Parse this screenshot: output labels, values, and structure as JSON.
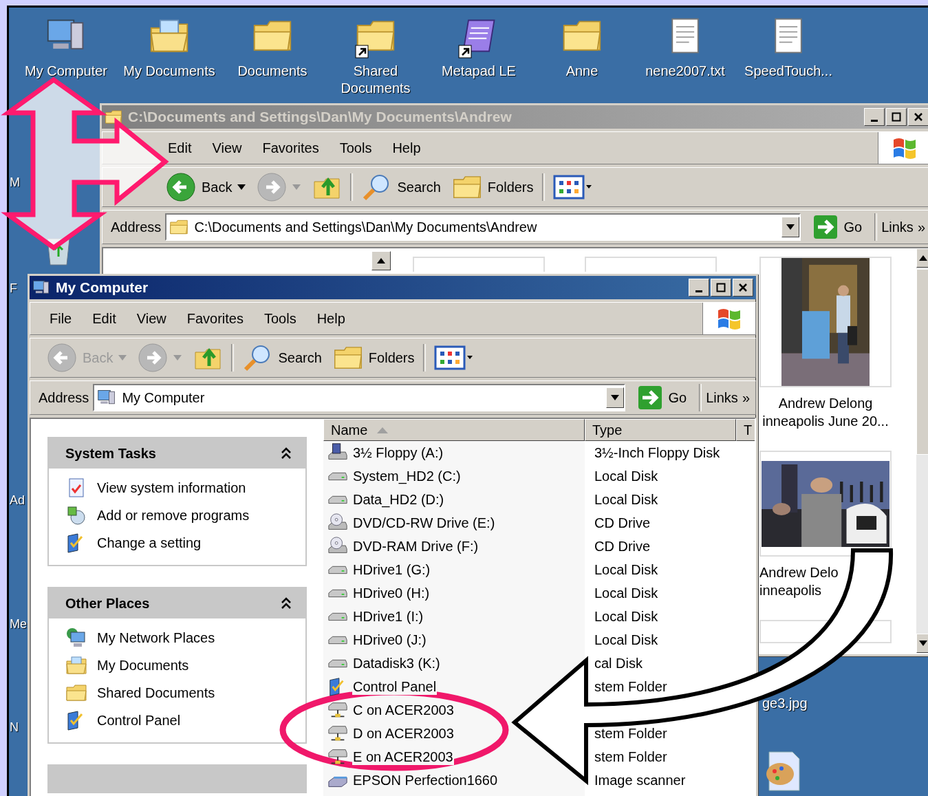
{
  "desktop": {
    "icons": [
      {
        "label": "My Computer",
        "kind": "computer",
        "shortcut": false
      },
      {
        "label": "My Documents",
        "kind": "documents",
        "shortcut": false
      },
      {
        "label": "Documents",
        "kind": "folder",
        "shortcut": false
      },
      {
        "label": "Shared Documents",
        "kind": "folder",
        "shortcut": true
      },
      {
        "label": "Metapad LE",
        "kind": "notepad",
        "shortcut": true
      },
      {
        "label": "Anne",
        "kind": "folder",
        "shortcut": false
      },
      {
        "label": "nene2007.txt",
        "kind": "text",
        "shortcut": false
      },
      {
        "label": "SpeedTouch...",
        "kind": "text",
        "shortcut": false
      }
    ],
    "edge_labels": [
      "M",
      "F",
      "Ad",
      "Me",
      "N"
    ],
    "file_label": "ge3.jpg"
  },
  "back_window": {
    "title": "C:\\Documents and Settings\\Dan\\My Documents\\Andrew",
    "active": false,
    "menu": [
      "Edit",
      "View",
      "Favorites",
      "Tools",
      "Help"
    ],
    "toolbar": {
      "back": "Back",
      "back_enabled": true,
      "search": "Search",
      "folders": "Folders"
    },
    "address": {
      "label": "Address",
      "value": "C:\\Documents and Settings\\Dan\\My Documents\\Andrew",
      "go": "Go",
      "links": "Links",
      "more": "»"
    },
    "thumbnails": [
      {
        "caption": [
          "Andrew Delong",
          "inneapolis June 20..."
        ]
      },
      {
        "caption": [
          "Andrew Delo",
          "inneapolis"
        ]
      }
    ]
  },
  "window": {
    "title": "My Computer",
    "active": true,
    "menu": [
      "File",
      "Edit",
      "View",
      "Favorites",
      "Tools",
      "Help"
    ],
    "toolbar": {
      "back": "Back",
      "back_enabled": false,
      "search": "Search",
      "folders": "Folders"
    },
    "address": {
      "label": "Address",
      "value": "My Computer",
      "go": "Go",
      "links": "Links",
      "more": "»"
    },
    "panels": [
      {
        "title": "System Tasks",
        "expanded": true,
        "items": [
          {
            "label": "View system information",
            "kind": "info"
          },
          {
            "label": "Add or remove programs",
            "kind": "programs"
          },
          {
            "label": "Change a setting",
            "kind": "panel"
          }
        ]
      },
      {
        "title": "Other Places",
        "expanded": true,
        "items": [
          {
            "label": "My Network Places",
            "kind": "network"
          },
          {
            "label": "My Documents",
            "kind": "documents"
          },
          {
            "label": "Shared Documents",
            "kind": "folder"
          },
          {
            "label": "Control Panel",
            "kind": "panel"
          }
        ]
      }
    ],
    "columns": [
      {
        "label": "Name",
        "sorted": true
      },
      {
        "label": "Type",
        "sorted": false
      },
      {
        "label": "T"
      }
    ],
    "rows": [
      {
        "name": "3½ Floppy (A:)",
        "type": "3½-Inch Floppy Disk",
        "kind": "floppy"
      },
      {
        "name": "System_HD2 (C:)",
        "type": "Local Disk",
        "kind": "disk"
      },
      {
        "name": "Data_HD2 (D:)",
        "type": "Local Disk",
        "kind": "disk"
      },
      {
        "name": "DVD/CD-RW Drive (E:)",
        "type": "CD Drive",
        "kind": "cd"
      },
      {
        "name": "DVD-RAM Drive (F:)",
        "type": "CD Drive",
        "kind": "cd"
      },
      {
        "name": "HDrive1 (G:)",
        "type": "Local Disk",
        "kind": "disk"
      },
      {
        "name": "HDrive0 (H:)",
        "type": "Local Disk",
        "kind": "disk"
      },
      {
        "name": "HDrive1 (I:)",
        "type": "Local Disk",
        "kind": "disk"
      },
      {
        "name": "HDrive0 (J:)",
        "type": "Local Disk",
        "kind": "disk"
      },
      {
        "name": "Datadisk3 (K:)",
        "type": "cal Disk",
        "kind": "disk"
      },
      {
        "name": "Control Panel",
        "type": "stem Folder",
        "kind": "panel"
      },
      {
        "name": "C on ACER2003",
        "kind": "netdrive"
      },
      {
        "name": "D on ACER2003",
        "type": "stem Folder",
        "kind": "netdrive"
      },
      {
        "name": "E on ACER2003",
        "type": "stem Folder",
        "kind": "netdrive"
      },
      {
        "name": "EPSON Perfection1660",
        "type": "Image scanner",
        "kind": "scanner"
      }
    ]
  }
}
